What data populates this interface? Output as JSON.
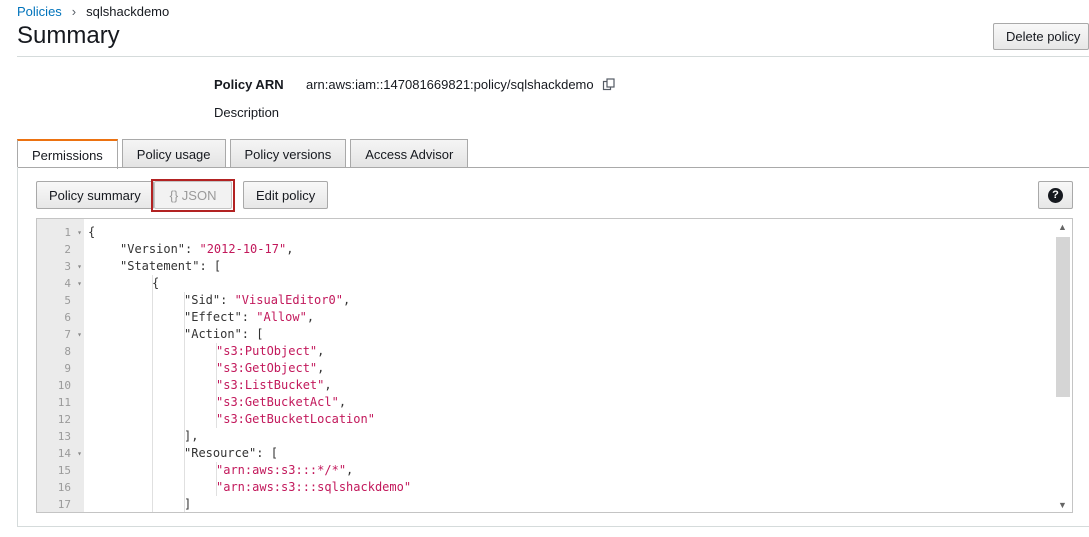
{
  "breadcrumb": {
    "root": "Policies",
    "current": "sqlshackdemo"
  },
  "page": {
    "title": "Summary",
    "delete_label": "Delete policy"
  },
  "meta": {
    "arn_label": "Policy ARN",
    "arn_value": "arn:aws:iam::147081669821:policy/sqlshackdemo",
    "description_label": "Description"
  },
  "tabs": [
    {
      "label": "Permissions",
      "active": true
    },
    {
      "label": "Policy usage",
      "active": false
    },
    {
      "label": "Policy versions",
      "active": false
    },
    {
      "label": "Access Advisor",
      "active": false
    }
  ],
  "toolbar": {
    "policy_summary_label": "Policy summary",
    "json_label": "{} JSON",
    "edit_policy_label": "Edit policy",
    "help_label": "?"
  },
  "editor": {
    "lines": [
      {
        "n": "1",
        "fold": true,
        "indent": 0,
        "parts": [
          [
            "p",
            "{"
          ]
        ]
      },
      {
        "n": "2",
        "fold": false,
        "indent": 1,
        "parts": [
          [
            "k",
            "\"Version\""
          ],
          [
            "p",
            ": "
          ],
          [
            "s",
            "\"2012-10-17\""
          ],
          [
            "p",
            ","
          ]
        ]
      },
      {
        "n": "3",
        "fold": true,
        "indent": 1,
        "parts": [
          [
            "k",
            "\"Statement\""
          ],
          [
            "p",
            ": ["
          ]
        ]
      },
      {
        "n": "4",
        "fold": true,
        "indent": 2,
        "parts": [
          [
            "p",
            "{"
          ]
        ]
      },
      {
        "n": "5",
        "fold": false,
        "indent": 3,
        "parts": [
          [
            "k",
            "\"Sid\""
          ],
          [
            "p",
            ": "
          ],
          [
            "s",
            "\"VisualEditor0\""
          ],
          [
            "p",
            ","
          ]
        ]
      },
      {
        "n": "6",
        "fold": false,
        "indent": 3,
        "parts": [
          [
            "k",
            "\"Effect\""
          ],
          [
            "p",
            ": "
          ],
          [
            "s",
            "\"Allow\""
          ],
          [
            "p",
            ","
          ]
        ]
      },
      {
        "n": "7",
        "fold": true,
        "indent": 3,
        "parts": [
          [
            "k",
            "\"Action\""
          ],
          [
            "p",
            ": ["
          ]
        ]
      },
      {
        "n": "8",
        "fold": false,
        "indent": 4,
        "parts": [
          [
            "s",
            "\"s3:PutObject\""
          ],
          [
            "p",
            ","
          ]
        ]
      },
      {
        "n": "9",
        "fold": false,
        "indent": 4,
        "parts": [
          [
            "s",
            "\"s3:GetObject\""
          ],
          [
            "p",
            ","
          ]
        ]
      },
      {
        "n": "10",
        "fold": false,
        "indent": 4,
        "parts": [
          [
            "s",
            "\"s3:ListBucket\""
          ],
          [
            "p",
            ","
          ]
        ]
      },
      {
        "n": "11",
        "fold": false,
        "indent": 4,
        "parts": [
          [
            "s",
            "\"s3:GetBucketAcl\""
          ],
          [
            "p",
            ","
          ]
        ]
      },
      {
        "n": "12",
        "fold": false,
        "indent": 4,
        "parts": [
          [
            "s",
            "\"s3:GetBucketLocation\""
          ]
        ]
      },
      {
        "n": "13",
        "fold": false,
        "indent": 3,
        "parts": [
          [
            "p",
            "],"
          ]
        ]
      },
      {
        "n": "14",
        "fold": true,
        "indent": 3,
        "parts": [
          [
            "k",
            "\"Resource\""
          ],
          [
            "p",
            ": ["
          ]
        ]
      },
      {
        "n": "15",
        "fold": false,
        "indent": 4,
        "parts": [
          [
            "s",
            "\"arn:aws:s3:::*/*\""
          ],
          [
            "p",
            ","
          ]
        ]
      },
      {
        "n": "16",
        "fold": false,
        "indent": 4,
        "parts": [
          [
            "s",
            "\"arn:aws:s3:::sqlshackdemo\""
          ]
        ]
      },
      {
        "n": "17",
        "fold": false,
        "indent": 3,
        "parts": [
          [
            "p",
            "]"
          ]
        ]
      }
    ]
  },
  "colors": {
    "link": "#0073bb",
    "active_tab": "#ec7211",
    "string": "#c2185b",
    "highlight": "#b22222"
  }
}
